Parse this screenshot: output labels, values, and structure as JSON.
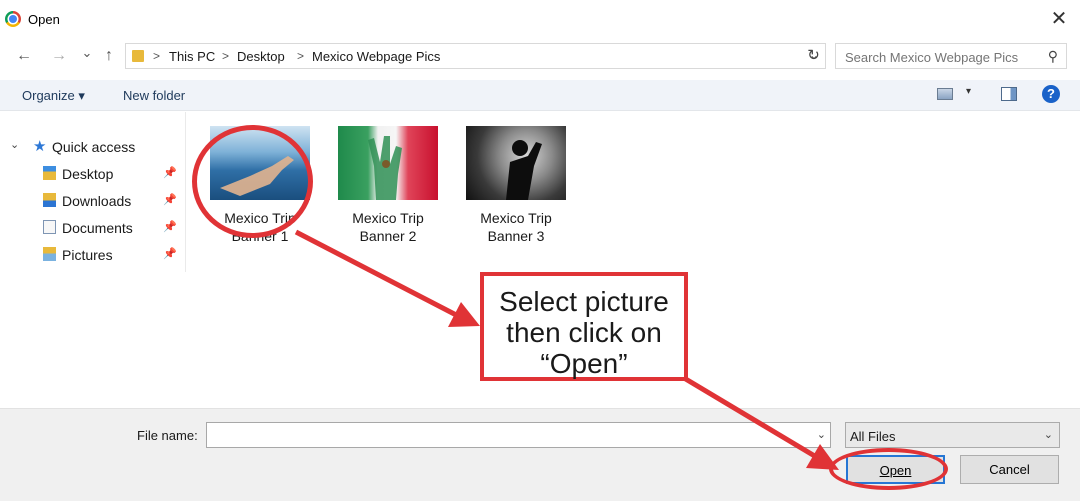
{
  "window": {
    "title": "Open",
    "app_icon": "chrome-icon"
  },
  "nav": {
    "back_icon": "←",
    "forward_icon": "→",
    "recent_icon": "⌄",
    "up_icon": "↑"
  },
  "address": {
    "crumbs": [
      "This PC",
      "Desktop",
      "Mexico Webpage Pics"
    ],
    "separator": ">",
    "dropdown_icon": "⌄",
    "refresh_icon": "↻"
  },
  "search": {
    "placeholder": "Search Mexico Webpage Pics",
    "icon": "⚲"
  },
  "toolbar": {
    "organize_label": "Organize ▾",
    "new_folder_label": "New folder",
    "view_dropdown": "▾",
    "help": "?"
  },
  "sidebar": {
    "quick_access_label": "Quick access",
    "items": [
      {
        "label": "Desktop",
        "icon": "desktop-folder-icon"
      },
      {
        "label": "Downloads",
        "icon": "downloads-folder-icon"
      },
      {
        "label": "Documents",
        "icon": "documents-folder-icon"
      },
      {
        "label": "Pictures",
        "icon": "pictures-folder-icon"
      }
    ],
    "pin_icon": "📌"
  },
  "files": [
    {
      "line1": "Mexico Trip",
      "line2": "Banner 1"
    },
    {
      "line1": "Mexico Trip",
      "line2": "Banner 2"
    },
    {
      "line1": "Mexico Trip",
      "line2": "Banner 3"
    }
  ],
  "footer": {
    "file_name_label": "File name:",
    "file_name_value": "",
    "filter_value": "All Files",
    "open_label": "Open",
    "cancel_label": "Cancel"
  },
  "annotation": {
    "callout_lines": [
      "Select picture",
      "then click on",
      "“Open”"
    ],
    "color": "#e03336"
  }
}
